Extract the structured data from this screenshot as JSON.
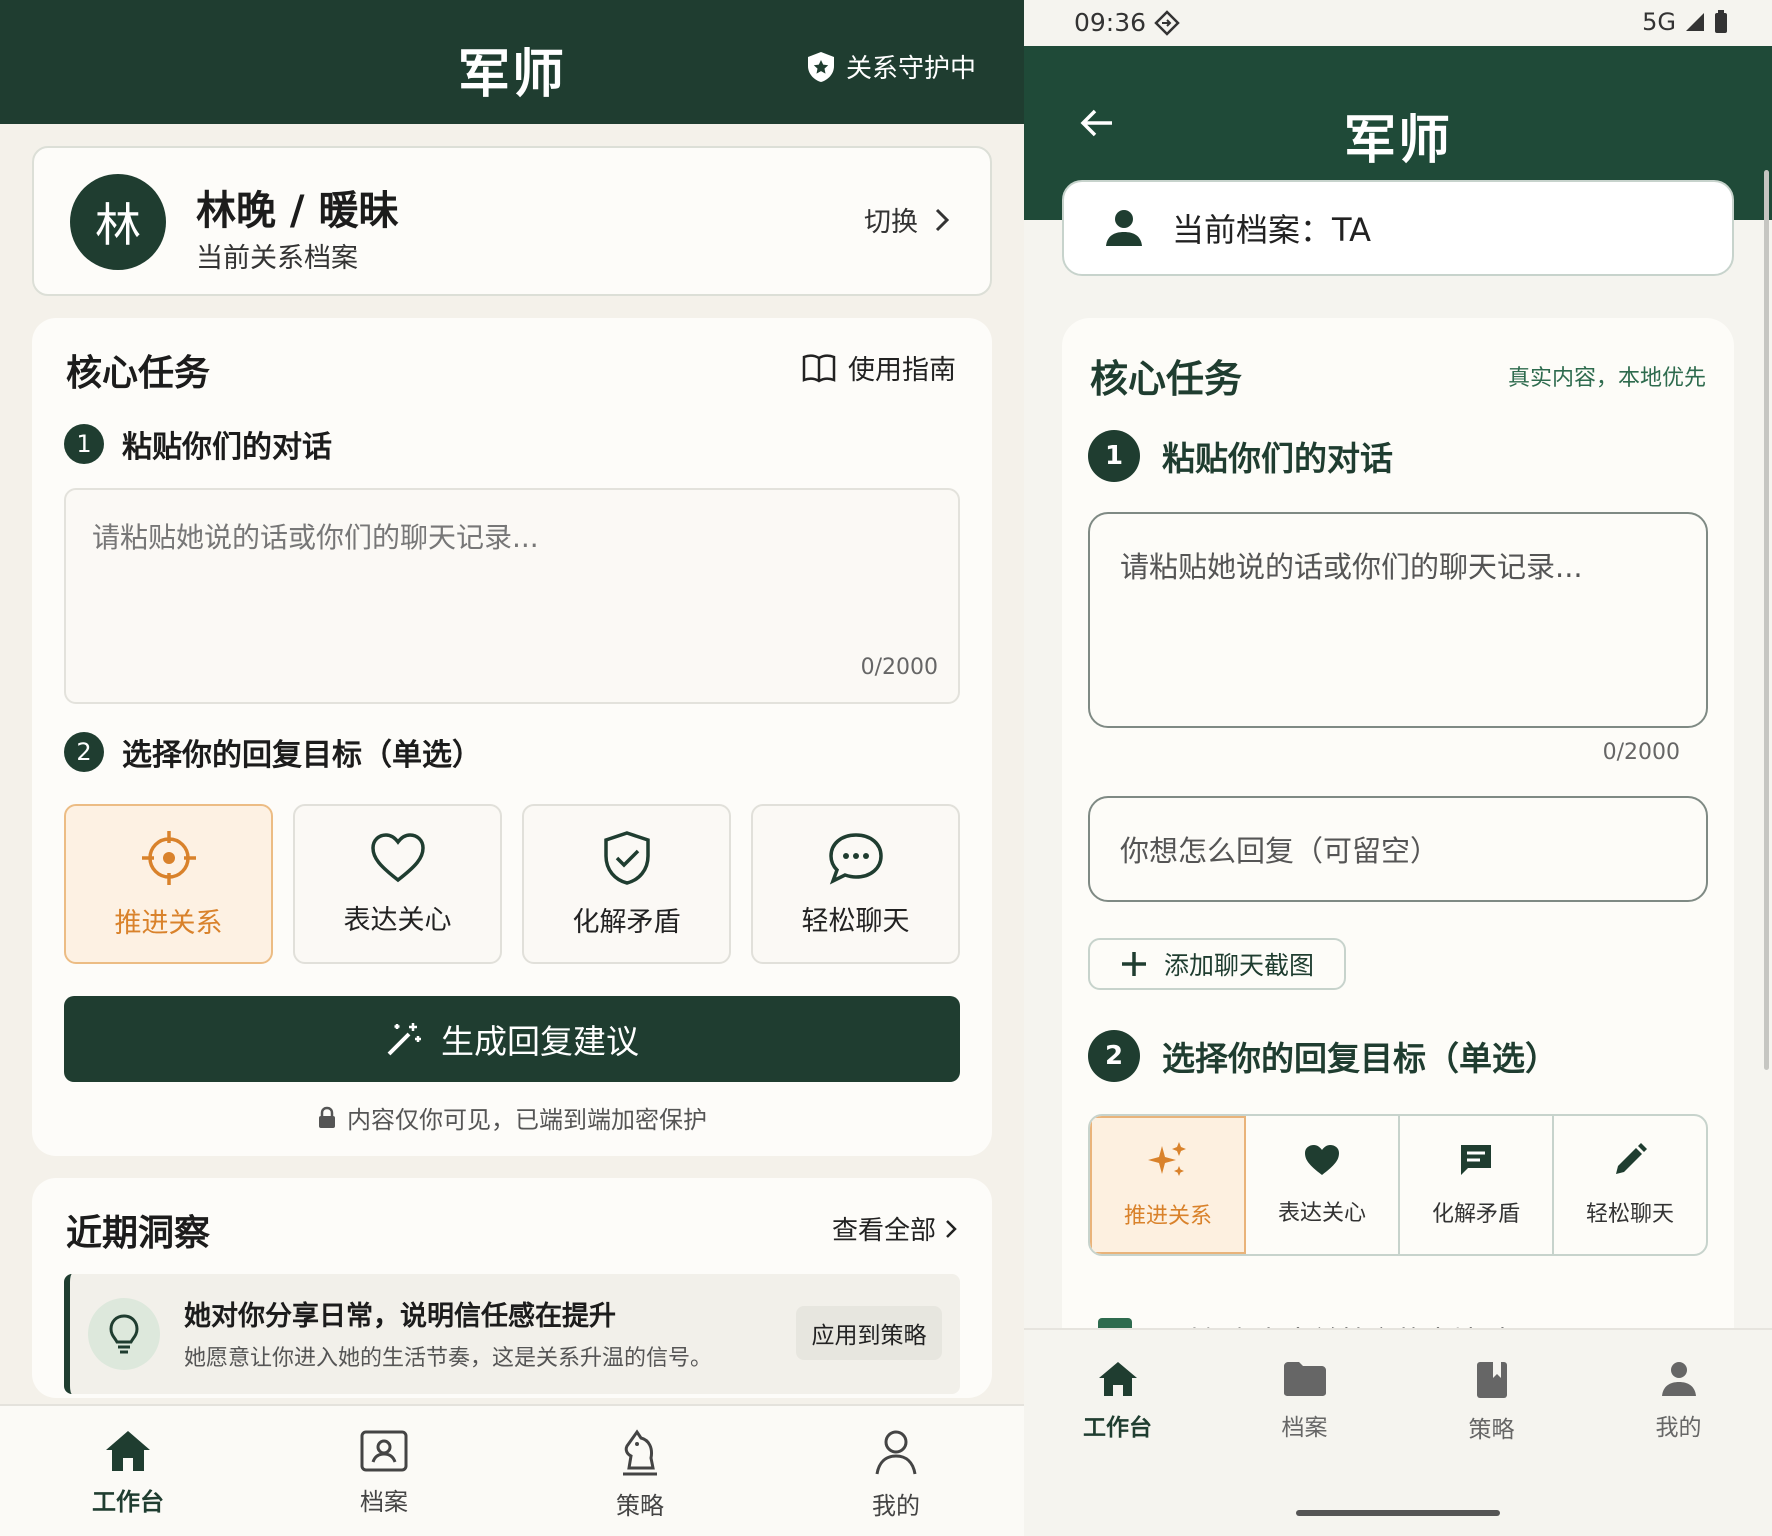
{
  "left": {
    "header": {
      "title": "军师",
      "guard": "关系守护中"
    },
    "profile": {
      "avatar": "林",
      "name": "林晚 / 暖昧",
      "subtitle": "当前关系档案",
      "switch": "切换"
    },
    "task": {
      "title": "核心任务",
      "guide": "使用指南",
      "step1": {
        "num": "1",
        "label": "粘贴你们的对话"
      },
      "textarea": {
        "placeholder": "请粘贴她说的话或你们的聊天记录...",
        "count": "0/2000"
      },
      "step2": {
        "num": "2",
        "label": "选择你的回复目标（单选）"
      },
      "goals": [
        {
          "label": "推进关系",
          "icon": "target-icon",
          "selected": true
        },
        {
          "label": "表达关心",
          "icon": "heart-icon",
          "selected": false
        },
        {
          "label": "化解矛盾",
          "icon": "shield-check-icon",
          "selected": false
        },
        {
          "label": "轻松聊天",
          "icon": "chat-bubble-icon",
          "selected": false
        }
      ],
      "generate": "生成回复建议",
      "privacy": "内容仅你可见，已端到端加密保护"
    },
    "insights": {
      "title": "近期洞察",
      "view_all": "查看全部",
      "item": {
        "title": "她对你分享日常，说明信任感在提升",
        "desc": "她愿意让你进入她的生活节奏，这是关系升温的信号。",
        "apply": "应用到策略"
      }
    },
    "nav": [
      {
        "label": "工作台",
        "icon": "home-icon",
        "active": true
      },
      {
        "label": "档案",
        "icon": "profile-folder-icon",
        "active": false
      },
      {
        "label": "策略",
        "icon": "chess-knight-icon",
        "active": false
      },
      {
        "label": "我的",
        "icon": "person-icon",
        "active": false
      }
    ]
  },
  "right": {
    "status": {
      "time": "09:36",
      "network": "5G"
    },
    "header": {
      "title": "军师"
    },
    "current_profile": "当前档案：TA",
    "task": {
      "title": "核心任务",
      "local_hint": "真实内容，本地优先",
      "step1": {
        "num": "1",
        "label": "粘贴你们的对话"
      },
      "textarea": {
        "placeholder": "请粘贴她说的话或你们的聊天记录...",
        "count": "0/2000"
      },
      "reply_input": {
        "placeholder": "你想怎么回复（可留空）"
      },
      "add_screenshot": "添加聊天截图",
      "step2": {
        "num": "2",
        "label": "选择你的回复目标（单选）"
      },
      "goals": [
        {
          "label": "推进关系",
          "icon": "sparkle-icon",
          "selected": true
        },
        {
          "label": "表达关心",
          "icon": "heart-icon",
          "selected": false
        },
        {
          "label": "化解矛盾",
          "icon": "message-icon",
          "selected": false
        },
        {
          "label": "轻松聊天",
          "icon": "pencil-icon",
          "selected": false
        }
      ],
      "save_local": "同时保存为当前档案的本地对话记录"
    },
    "nav": [
      {
        "label": "工作台",
        "icon": "home-icon",
        "active": true
      },
      {
        "label": "档案",
        "icon": "folder-icon",
        "active": false
      },
      {
        "label": "策略",
        "icon": "book-icon",
        "active": false
      },
      {
        "label": "我的",
        "icon": "person-icon",
        "active": false
      }
    ]
  },
  "colors": {
    "primary": "#1f3d30",
    "accent": "#d9822b",
    "accent_bg": "#fdf1e3"
  }
}
